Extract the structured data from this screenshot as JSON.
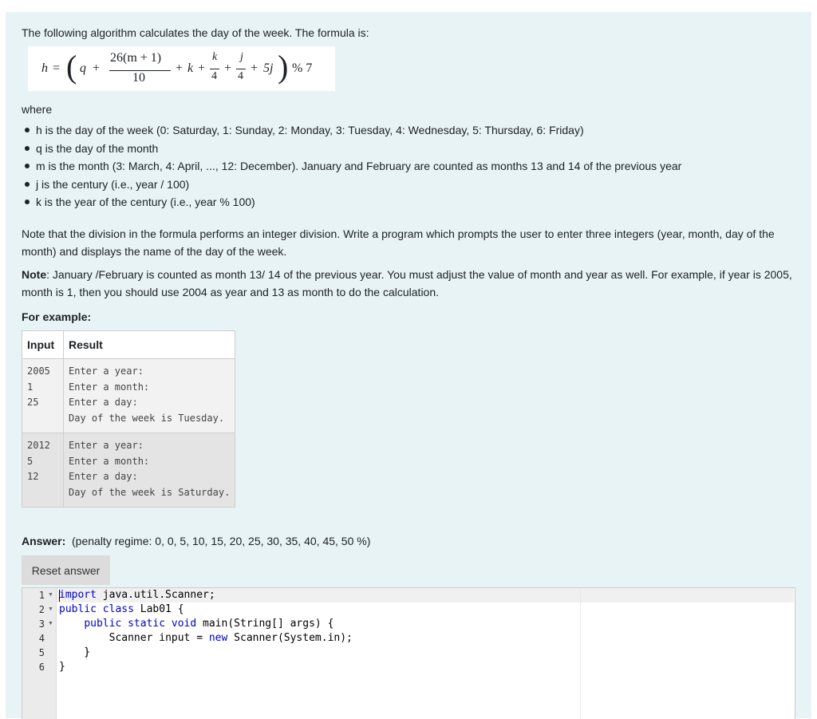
{
  "intro": "The following algorithm calculates the day of the week. The formula is:",
  "formula": {
    "h": "h",
    "eq": "=",
    "q": "q",
    "plus": "+",
    "num": "26(m + 1)",
    "den": "10",
    "k": "k",
    "four": "4",
    "j": "j",
    "fivej": "5j",
    "mod": "% 7"
  },
  "where": "where",
  "definitions": [
    "h is the day of the week (0: Saturday, 1: Sunday, 2: Monday, 3: Tuesday, 4: Wednesday, 5: Thursday, 6: Friday)",
    "q is the day of the month",
    "m is the month (3: March, 4: April, ..., 12: December). January and February are counted as months 13 and 14 of the previous year",
    "j is the century (i.e., year / 100)",
    "k is the year of the century (i.e., year % 100)"
  ],
  "note1": "Note that the division in the formula performs an integer division. Write a program which prompts the user to enter three integers (year, month, day of the month) and displays the name of the day of the week.",
  "note2": {
    "label": "Note",
    "text": ": January /February is counted as month 13/ 14 of the previous year.  You must adjust the value of month and year as well. For example, if year is 2005, month is 1, then you should use 2004 as year and 13 as month to do the calculation."
  },
  "for_example": "For example:",
  "table": {
    "headers": [
      "Input",
      "Result"
    ],
    "rows": [
      {
        "input": "2005\n1\n25",
        "result": "Enter a year:\nEnter a month:\nEnter a day:\nDay of the week is Tuesday."
      },
      {
        "input": "2012\n5\n12",
        "result": "Enter a year:\nEnter a month:\nEnter a day:\nDay of the week is Saturday."
      }
    ]
  },
  "answer": {
    "label": "Answer:",
    "penalty": "(penalty regime: 0, 0, 5, 10, 15, 20, 25, 30, 35, 40, 45, 50 %)"
  },
  "reset_label": "Reset answer",
  "code": {
    "l1_kw": "import",
    "l1_rest": " java.util.Scanner;",
    "l2_kw": "public class",
    "l2_rest": " Lab01 {",
    "l3_indent": "    ",
    "l3_kw": "public static void",
    "l3_rest": " main(String[] args) {",
    "l4_indent": "        ",
    "l4_a": "Scanner input = ",
    "l4_kw": "new",
    "l4_b": " Scanner(System.in);",
    "l5": "    }",
    "l6": "}"
  },
  "line_numbers": [
    "1",
    "2",
    "3",
    "4",
    "5",
    "6"
  ]
}
